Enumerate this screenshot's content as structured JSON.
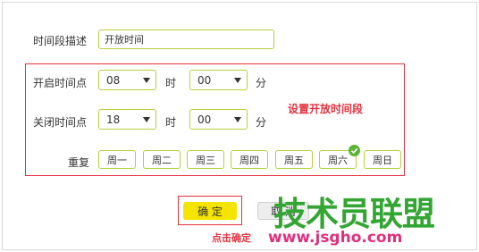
{
  "form": {
    "desc_label": "时间段描述",
    "desc_value": "开放时间",
    "start_label": "开启时间点",
    "start_hour": "08",
    "start_minute": "00",
    "end_label": "关闭时间点",
    "end_hour": "18",
    "end_minute": "00",
    "hour_unit": "时",
    "minute_unit": "分",
    "repeat_label": "重复",
    "days": [
      "周一",
      "周二",
      "周三",
      "周四",
      "周五",
      "周六",
      "周日"
    ],
    "checked_day": "周六"
  },
  "annotations": {
    "set_note": "设置开放时间段",
    "click_note": "点击确定"
  },
  "buttons": {
    "ok": "确 定",
    "cancel": "取 消"
  },
  "watermark": {
    "cn": "技术员联盟",
    "url": "www.jsgho.com"
  },
  "colors": {
    "accent_border": "#b5cf3c",
    "ok_bg": "#f5e400",
    "highlight_red": "#e33340",
    "check_green": "#5cb531",
    "watermark_green": "#33a532",
    "watermark_pink": "#e0307c"
  }
}
